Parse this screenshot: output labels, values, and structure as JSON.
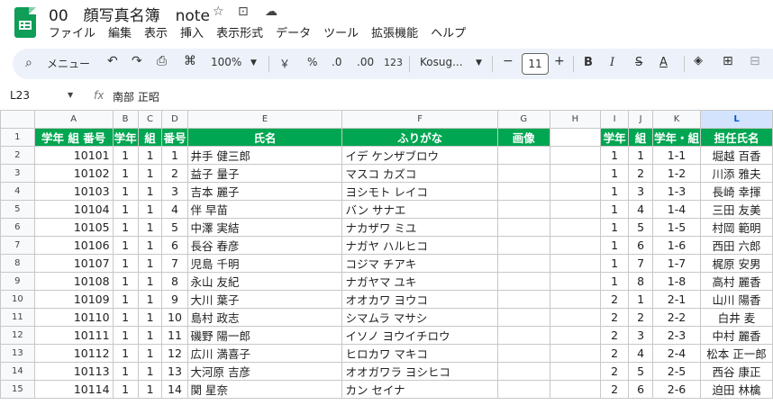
{
  "app": {
    "doc_title": "00　顔写真名簿　note",
    "menu": [
      "ファイル",
      "編集",
      "表示",
      "挿入",
      "表示形式",
      "データ",
      "ツール",
      "拡張機能",
      "ヘルプ"
    ]
  },
  "toolbar": {
    "search_label": "メニュー",
    "zoom": "100%",
    "currency": "￥",
    "percent": "%",
    "dec_less": ".0",
    "dec_more": ".00",
    "num_format": "123",
    "font": "Kosug...",
    "font_size": "11"
  },
  "formula_bar": {
    "cell_ref": "L23",
    "fx": "fx",
    "value": "南部 正昭"
  },
  "columns": [
    "A",
    "B",
    "C",
    "D",
    "E",
    "F",
    "G",
    "H",
    "I",
    "J",
    "K",
    "L"
  ],
  "header_row": [
    "学年 組 番号",
    "学年",
    "組",
    "番号",
    "氏名",
    "ふりがな",
    "画像",
    "",
    "学年",
    "組",
    "学年・組",
    "担任氏名"
  ],
  "rows": [
    [
      "10101",
      "1",
      "1",
      "1",
      "井手 健三郎",
      "イデ ケンザブロウ",
      "",
      "",
      "1",
      "1",
      "1-1",
      "堀越 百香"
    ],
    [
      "10102",
      "1",
      "1",
      "2",
      "益子 量子",
      "マスコ カズコ",
      "",
      "",
      "1",
      "2",
      "1-2",
      "川添 雅夫"
    ],
    [
      "10103",
      "1",
      "1",
      "3",
      "吉本 麗子",
      "ヨシモト レイコ",
      "",
      "",
      "1",
      "3",
      "1-3",
      "長崎 幸揮"
    ],
    [
      "10104",
      "1",
      "1",
      "4",
      "伴 早苗",
      "バン サナエ",
      "",
      "",
      "1",
      "4",
      "1-4",
      "三田 友美"
    ],
    [
      "10105",
      "1",
      "1",
      "5",
      "中澤 実結",
      "ナカザワ ミユ",
      "",
      "",
      "1",
      "5",
      "1-5",
      "村岡 範明"
    ],
    [
      "10106",
      "1",
      "1",
      "6",
      "長谷 春彦",
      "ナガヤ ハルヒコ",
      "",
      "",
      "1",
      "6",
      "1-6",
      "西田 六郎"
    ],
    [
      "10107",
      "1",
      "1",
      "7",
      "児島 千明",
      "コジマ チアキ",
      "",
      "",
      "1",
      "7",
      "1-7",
      "梶原 安男"
    ],
    [
      "10108",
      "1",
      "1",
      "8",
      "永山 友紀",
      "ナガヤマ ユキ",
      "",
      "",
      "1",
      "8",
      "1-8",
      "高村 麗香"
    ],
    [
      "10109",
      "1",
      "1",
      "9",
      "大川 葉子",
      "オオカワ ヨウコ",
      "",
      "",
      "2",
      "1",
      "2-1",
      "山川 陽香"
    ],
    [
      "10110",
      "1",
      "1",
      "10",
      "島村 政志",
      "シマムラ マサシ",
      "",
      "",
      "2",
      "2",
      "2-2",
      "白井 麦"
    ],
    [
      "10111",
      "1",
      "1",
      "11",
      "磯野 陽一郎",
      "イソノ ヨウイチロウ",
      "",
      "",
      "2",
      "3",
      "2-3",
      "中村 麗香"
    ],
    [
      "10112",
      "1",
      "1",
      "12",
      "広川 満喜子",
      "ヒロカワ マキコ",
      "",
      "",
      "2",
      "4",
      "2-4",
      "松本 正一郎"
    ],
    [
      "10113",
      "1",
      "1",
      "13",
      "大河原 吉彦",
      "オオガワラ ヨシヒコ",
      "",
      "",
      "2",
      "5",
      "2-5",
      "西谷 康正"
    ],
    [
      "10114",
      "1",
      "1",
      "14",
      "関 星奈",
      "カン セイナ",
      "",
      "",
      "2",
      "6",
      "2-6",
      "迫田 林檎"
    ]
  ]
}
